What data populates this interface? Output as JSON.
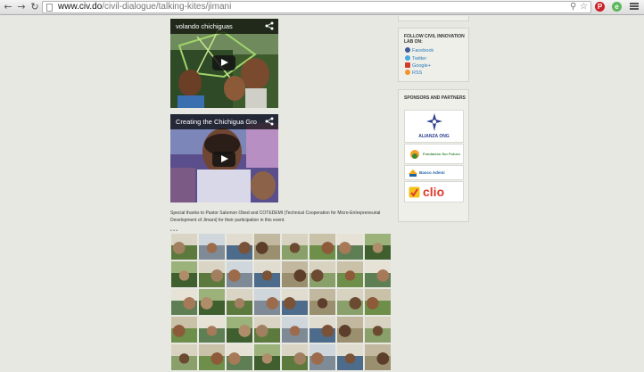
{
  "browser": {
    "url_host": "www.civ.do",
    "url_path": "/civil-dialogue/talking-kites/jimani"
  },
  "videos": [
    {
      "title": "volando chichiguas"
    },
    {
      "title": "Creating the Chichigua Gro"
    }
  ],
  "credit_text": "Special thanks to Pastor Salomon Obed and COTEDEMI (Technical Cooperation for Micro-Entrepreneurial Development of Jimani) for their participation in this event.",
  "gallery_marker": "• • •",
  "sidebar": {
    "follow": {
      "title": "FOLLOW CIVIL INNOVATION LAB ON:",
      "links": [
        {
          "label": "Facebook",
          "icon": "facebook-icon",
          "color": "#3b5998"
        },
        {
          "label": "Twitter",
          "icon": "twitter-icon",
          "color": "#4aa8e0"
        },
        {
          "label": "Google+",
          "icon": "google-plus-icon",
          "color": "#d23b2a"
        },
        {
          "label": "RSS",
          "icon": "rss-icon",
          "color": "#f29325"
        }
      ]
    },
    "sponsors": {
      "title": "SPONSORS AND PARTNERS",
      "logos": [
        {
          "name": "ALIANZA ONG",
          "color": "#2b3f8f"
        },
        {
          "name": "Fundación Sur Futuro",
          "color": "#3b8a3a"
        },
        {
          "name": "Banco Ademi",
          "color": "#1e63a8"
        },
        {
          "name": "clio",
          "color": "#e03a2c"
        }
      ]
    }
  }
}
